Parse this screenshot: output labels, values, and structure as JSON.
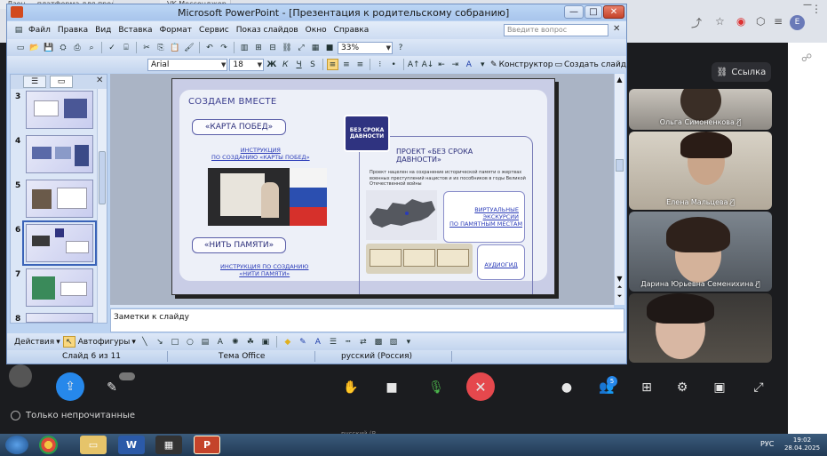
{
  "browser": {
    "tabs": [
      "Дзен — платформа для прос...",
      "VK Мессенджер"
    ],
    "profile_initial": "E"
  },
  "messenger": {
    "link_button": "Ссылка",
    "filter_label": "Только непрочитанные",
    "participants": [
      {
        "name": "Ольга Симоненкова"
      },
      {
        "name": "Елена Мальцева"
      },
      {
        "name": "Дарина Юрьевна Семенихина"
      }
    ],
    "participants_count": "5"
  },
  "taskbar": {
    "lang": "РУС",
    "time": "19:02",
    "date": "28.04.2025",
    "faded_status": "русский (Р"
  },
  "ppt": {
    "title": "Microsoft PowerPoint - [Презентация к родительскому собранию]",
    "menu": [
      "Файл",
      "Правка",
      "Вид",
      "Вставка",
      "Формат",
      "Сервис",
      "Показ слайдов",
      "Окно",
      "Справка"
    ],
    "help_placeholder": "Введите вопрос",
    "zoom": "33%",
    "font_name": "Arial",
    "font_size": "18",
    "designer_label": "Конструктор",
    "new_slide_label": "Создать слайд",
    "notes_placeholder": "Заметки к слайду",
    "actions_label": "Действия",
    "autoshapes_label": "Автофигуры",
    "status": {
      "slide": "Слайд 6 из 11",
      "theme": "Тема Office",
      "language": "русский (Россия)"
    },
    "thumbnails": [
      "3",
      "4",
      "5",
      "6",
      "7",
      "8"
    ],
    "selected_slide": "6"
  },
  "slide": {
    "header": "СОЗДАЕМ ВМЕСТЕ",
    "victory_map": "«КАРТА ПОБЕД»",
    "victory_link_1": "ИНСТРУКЦИЯ",
    "victory_link_2": "ПО СОЗДАНИЮ «КАРТЫ ПОБЕД»",
    "memory_thread": "«НИТЬ ПАМЯТИ»",
    "memory_link_1": "ИНСТРУКЦИЯ ПО СОЗДАНИЮ",
    "memory_link_2": "«НИТИ ПАМЯТИ»",
    "badge_1": "БЕЗ СРОКА",
    "badge_2": "ДАВНОСТИ",
    "project_title_1": "ПРОЕКТ «БЕЗ СРОКА",
    "project_title_2": "ДАВНОСТИ»",
    "project_text": "Проект нацелен на сохранение исторической памяти о жертвах военных преступлений нацистов и их пособников в годы Великой Отечественной войны",
    "virtual_1": "ВИРТУАЛЬНЫЕ",
    "virtual_2": "ЭКСКУРСИИ",
    "virtual_3": "ПО ПАМЯТНЫМ МЕСТАМ",
    "audio_guide": "АУДИОГИД"
  },
  "colors": {
    "accent_blue": "#2f3380",
    "end_call_red": "#e5484d",
    "call_action_blue": "#2688eb"
  }
}
